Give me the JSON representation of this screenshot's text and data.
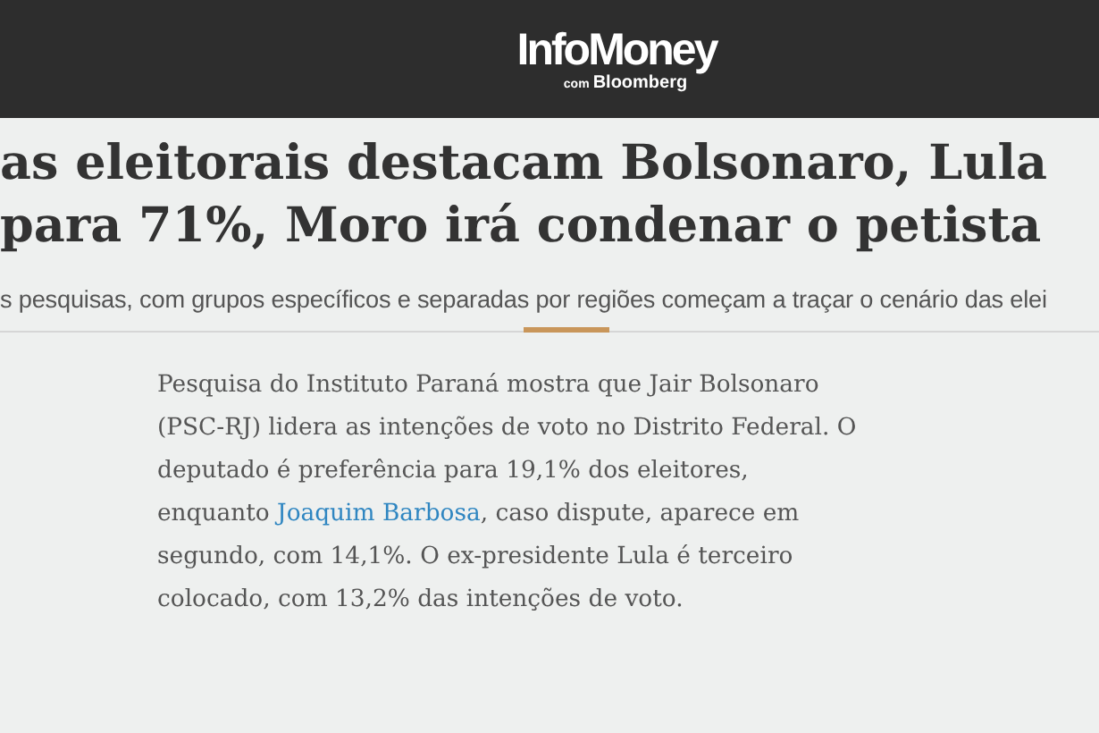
{
  "header": {
    "logo": "InfoMoney",
    "logo_sub_prefix": "com",
    "logo_sub": "Bloomberg"
  },
  "headline": [
    "as eleitorais destacam Bolsonaro, Lula",
    "para 71%, Moro irá condenar o petista"
  ],
  "subtitle": "s pesquisas, com grupos específicos e separadas por regiões começam a traçar o cenário das elei",
  "body": {
    "before": "Pesquisa do Instituto Paraná mostra que Jair Bolsonaro (PSC-RJ) lidera as intenções de voto no Distrito Federal. O deputado é preferência para 19,1% dos eleitores, enquanto ",
    "link": "Joaquim Barbosa",
    "after": ", caso dispute, aparece em segundo, com 14,1%. O ex-presidente Lula é terceiro colocado, com 13,2% das intenções de voto."
  }
}
